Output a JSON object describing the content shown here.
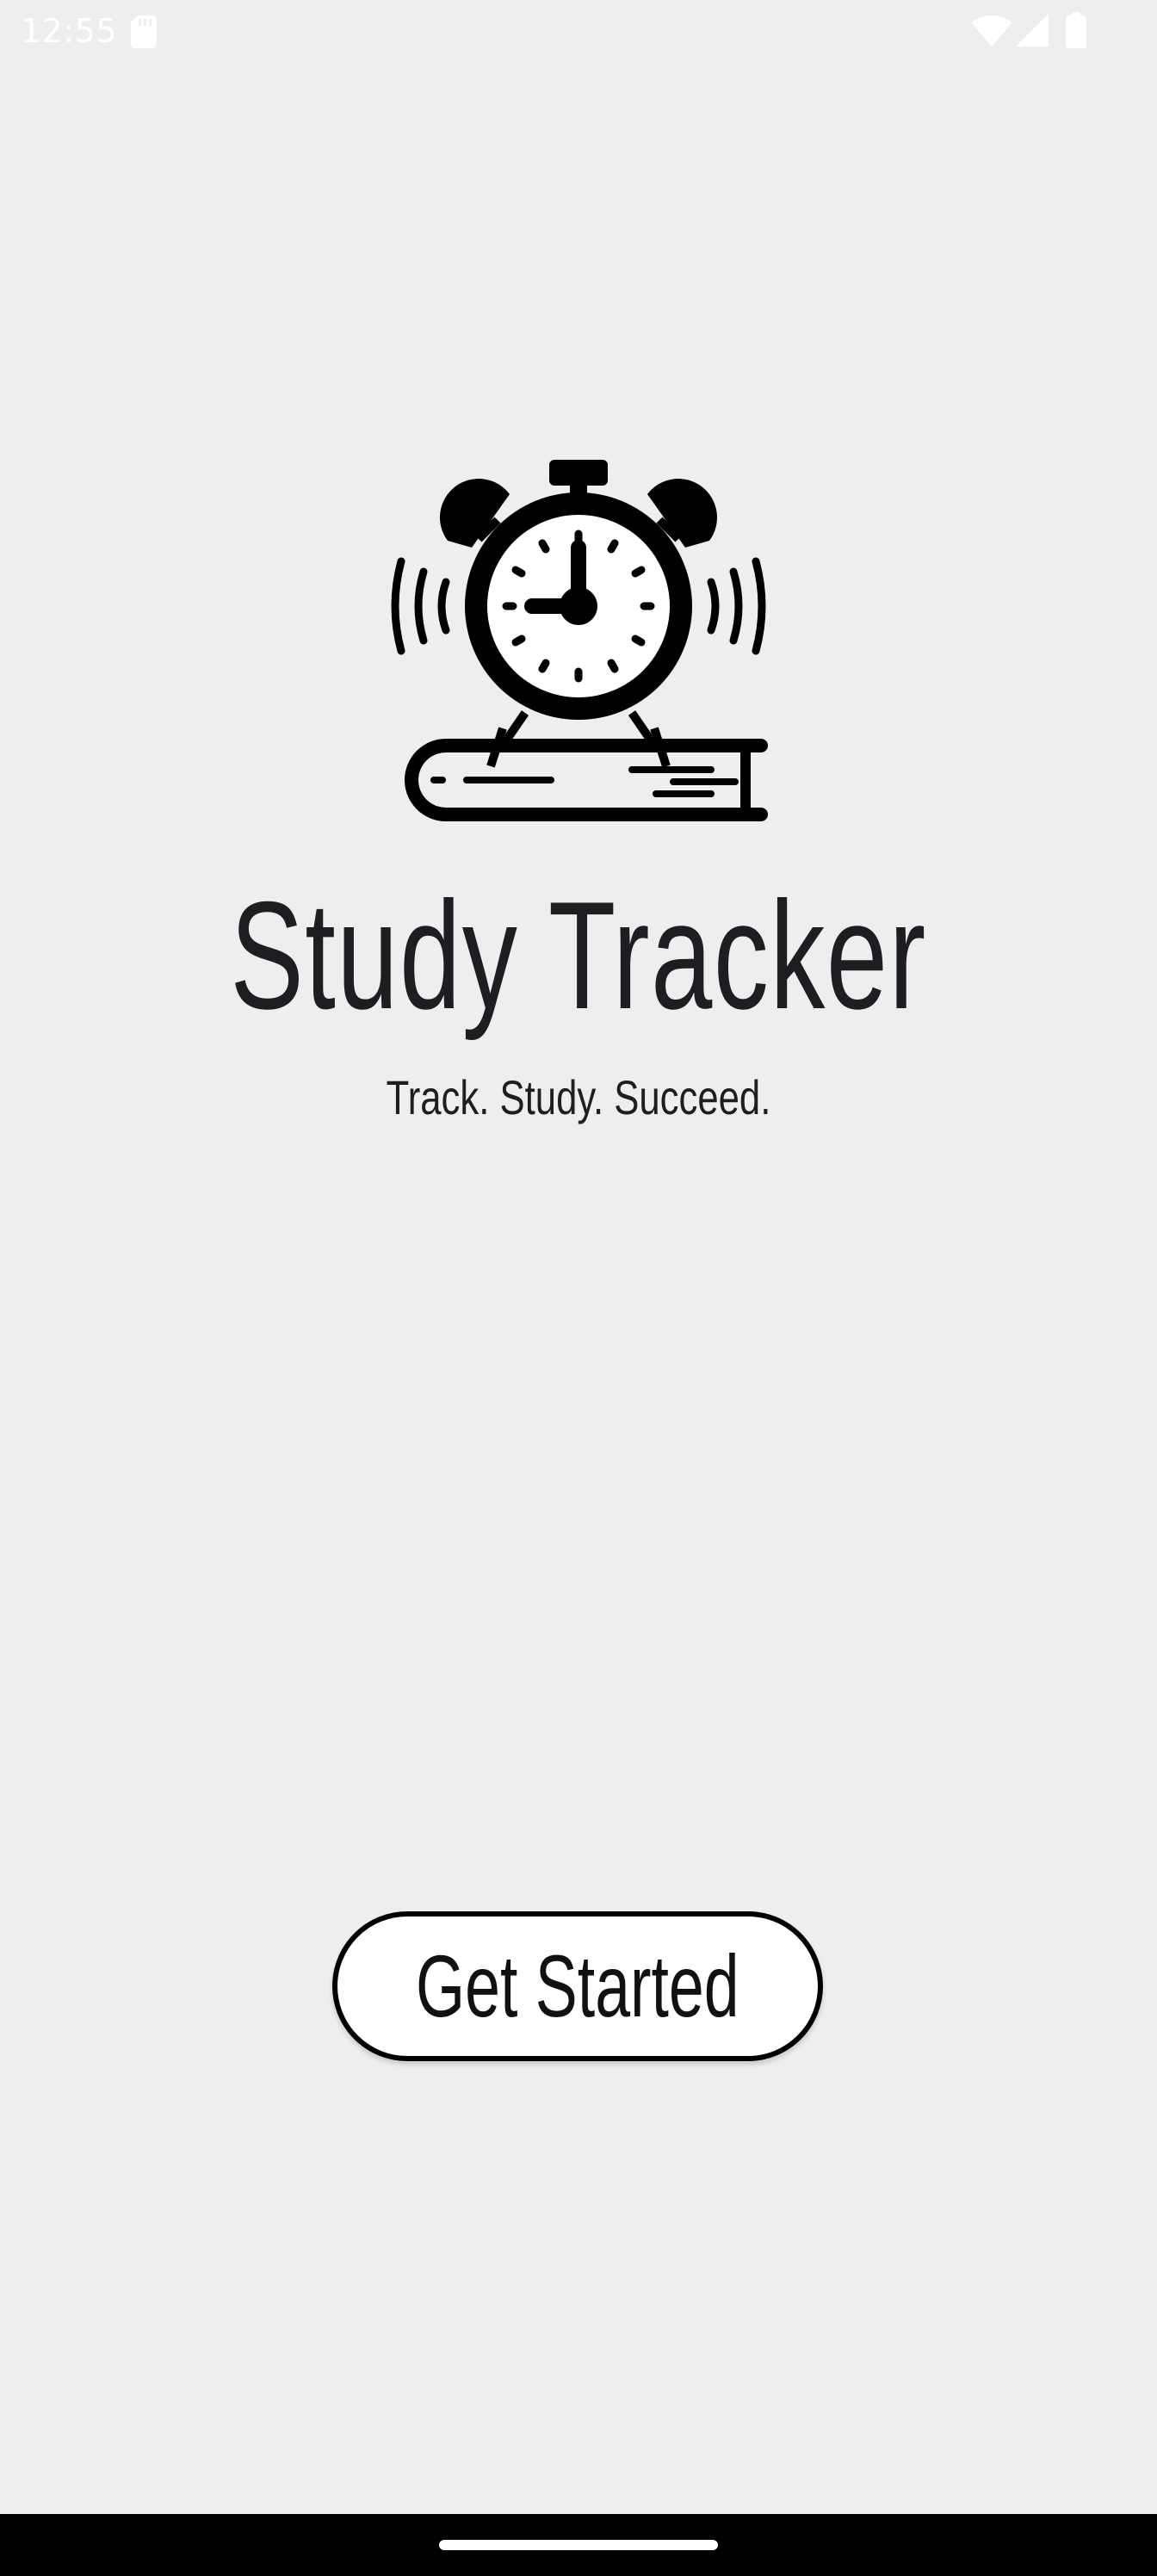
{
  "status_bar": {
    "time": "12:55",
    "icons": [
      "sd-card-icon",
      "wifi-icon",
      "signal-icon",
      "battery-icon"
    ]
  },
  "logo": {
    "icon": "alarm-clock-on-book-icon"
  },
  "app": {
    "title": "Study Tracker",
    "tagline": "Track. Study. Succeed."
  },
  "actions": {
    "get_started_label": "Get Started"
  },
  "colors": {
    "background": "#eeeeee",
    "text": "#1e1e22",
    "button_bg": "#ffffff",
    "button_border": "#000000",
    "nav_bar": "#000000"
  }
}
